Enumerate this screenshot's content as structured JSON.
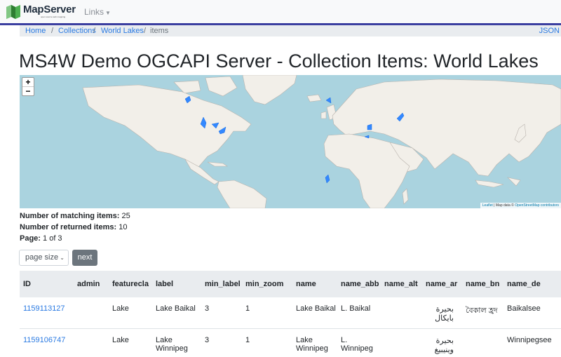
{
  "navbar": {
    "brand": "MapServer",
    "brand_sub": "open source web mapping",
    "links_label": "Links"
  },
  "breadcrumb": {
    "home": "Home",
    "collections": "Collections",
    "world_lakes": "World Lakes",
    "items": "items",
    "json": "JSON"
  },
  "page": {
    "title": "MS4W Demo OGCAPI Server - Collection Items: World Lakes"
  },
  "map": {
    "zoom_in": "+",
    "zoom_out": "−",
    "attrib_leaflet": "Leaflet",
    "attrib_mid": " | Map data © ",
    "attrib_osm": "OpenStreetMap contributors",
    "water_color": "#aad3df",
    "land_color": "#f2efe9",
    "lake_color": "#3388ff"
  },
  "stats": {
    "matching_label": "Number of matching items:",
    "matching_value": "25",
    "returned_label": "Number of returned items:",
    "returned_value": "10",
    "page_label": "Page:",
    "page_value": "1 of 3"
  },
  "controls": {
    "page_size": "page size",
    "next": "next"
  },
  "table": {
    "headers": [
      "ID",
      "admin",
      "featurecla",
      "label",
      "min_label",
      "min_zoom",
      "name",
      "name_abb",
      "name_alt",
      "name_ar",
      "name_bn",
      "name_de"
    ],
    "rows": [
      {
        "id": "1159113127",
        "admin": "",
        "featurecla": "Lake",
        "label": "Lake Baikal",
        "min_label": "3",
        "min_zoom": "1",
        "name": "Lake Baikal",
        "name_abb": "L. Baikal",
        "name_alt": "",
        "name_ar": "بحيرة بايكال",
        "name_bn": "বৈকাল হ্রদ",
        "name_de": "Baikalsee"
      },
      {
        "id": "1159106747",
        "admin": "",
        "featurecla": "Lake",
        "label": "Lake Winnipeg",
        "min_label": "3",
        "min_zoom": "1",
        "name": "Lake Winnipeg",
        "name_abb": "L. Winnipeg",
        "name_alt": "",
        "name_ar": "بحيرة وينيبيغ",
        "name_bn": "",
        "name_de": "Winnipegsee"
      }
    ]
  }
}
